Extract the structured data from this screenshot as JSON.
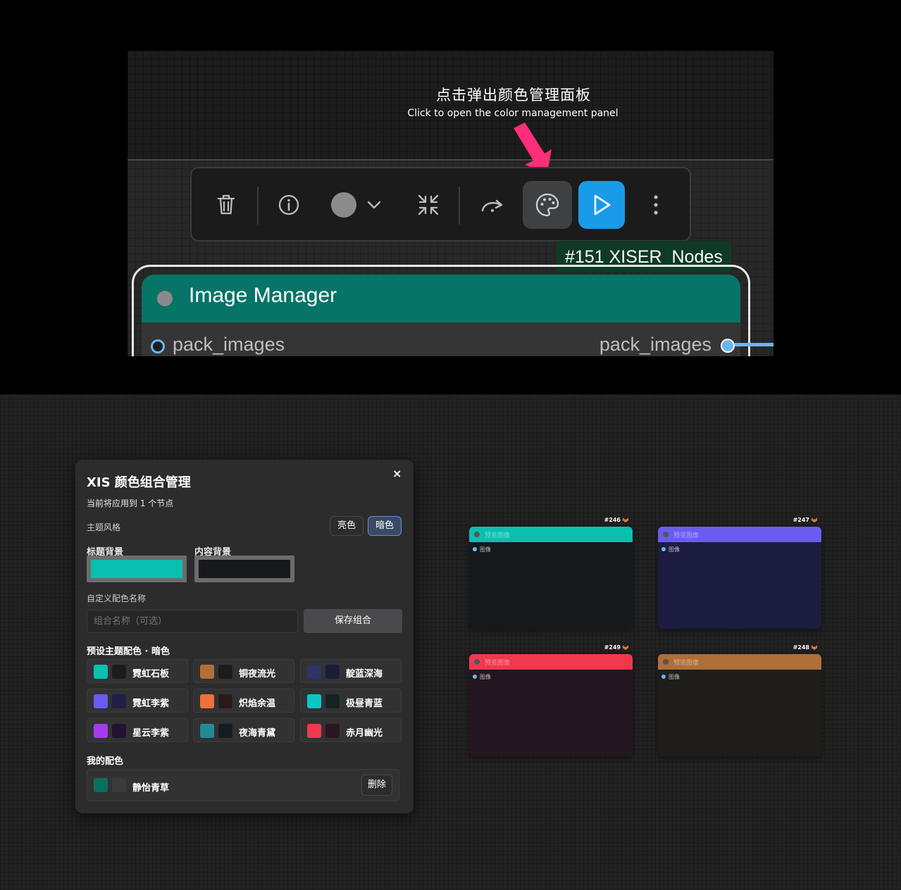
{
  "hint": {
    "title_cn": "点击弹出颜色管理面板",
    "title_en": "Click to open the color management panel"
  },
  "toolbar": {
    "icons": [
      "trash-icon",
      "info-icon",
      "color-dot-icon",
      "chevron-down-icon",
      "collapse-icon",
      "redo-icon",
      "palette-icon",
      "play-icon",
      "more-vertical-icon"
    ],
    "run_color": "#1a9be8"
  },
  "node": {
    "id_tag": "#151 XISER_Nodes",
    "title": "Image Manager",
    "input_label": "pack_images",
    "output_label": "pack_images",
    "header_color": "#077468"
  },
  "panel": {
    "title": "XIS 颜色组合管理",
    "close": "×",
    "subtitle": "当前将应用到 1 个节点",
    "theme_label": "主题风格",
    "theme_light": "亮色",
    "theme_dark": "暗色",
    "title_bg_label": "标题背景",
    "content_bg_label": "内容背景",
    "title_bg_color": "#0bbfae",
    "content_bg_color": "#16181c",
    "custom_label": "自定义配色名称",
    "name_placeholder": "组合名称（可选）",
    "save_label": "保存组合",
    "preset_label": "预设主题配色 · 暗色",
    "presets": [
      {
        "name": "霓虹石板",
        "c1": "#0bbfae",
        "c2": "#1a1c20"
      },
      {
        "name": "铜夜流光",
        "c1": "#b06e38",
        "c2": "#1f1c18"
      },
      {
        "name": "靛蓝深海",
        "c1": "#2c3566",
        "c2": "#1a1c38"
      },
      {
        "name": "霓虹李紫",
        "c1": "#6b5cf0",
        "c2": "#1f1f48"
      },
      {
        "name": "炽焰余温",
        "c1": "#f0703a",
        "c2": "#2a1a16"
      },
      {
        "name": "极昼青蓝",
        "c1": "#0bc6c6",
        "c2": "#132326"
      },
      {
        "name": "星云李紫",
        "c1": "#a63bf0",
        "c2": "#221430"
      },
      {
        "name": "夜海青黛",
        "c1": "#248a96",
        "c2": "#141c22"
      },
      {
        "name": "赤月幽光",
        "c1": "#f0384f",
        "c2": "#2a1620"
      }
    ],
    "mine_label": "我的配色",
    "mine": {
      "name": "静怡青草",
      "c1": "#087060",
      "c2": "#3a3a3c"
    },
    "delete_label": "删除"
  },
  "demo_nodes": [
    {
      "id": "#246",
      "title": "预览图像",
      "pin": "图像",
      "head": "#0bbfae",
      "body": "#16181c"
    },
    {
      "id": "#247",
      "title": "预览图像",
      "pin": "图像",
      "head": "#6b5cf0",
      "body": "#1c1d40"
    },
    {
      "id": "#249",
      "title": "预览图像",
      "pin": "图像",
      "head": "#f0384f",
      "body": "#231620"
    },
    {
      "id": "#248",
      "title": "预览图像",
      "pin": "图像",
      "head": "#b06e38",
      "body": "#1f1d1a"
    }
  ]
}
